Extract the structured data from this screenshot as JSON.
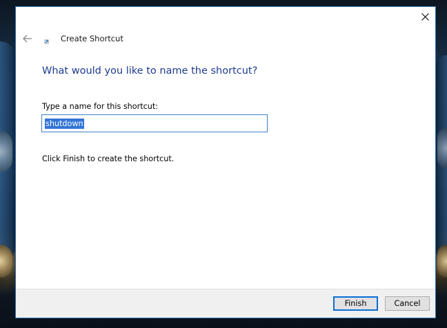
{
  "window": {
    "title": "Create Shortcut"
  },
  "icons": {
    "close": "close-icon",
    "back": "back-arrow-icon",
    "app": "shortcut-wizard-icon"
  },
  "page": {
    "heading": "What would you like to name the shortcut?",
    "field_label": "Type a name for this shortcut:",
    "field_value": "shutdown",
    "hint": "Click Finish to create the shortcut."
  },
  "buttons": {
    "finish_label": "Finish",
    "cancel_label": "Cancel"
  },
  "colors": {
    "heading": "#1e3c8f",
    "selection": "#3375d7",
    "focus_border": "#0a6dd6",
    "footer": "#f0f0f0"
  }
}
